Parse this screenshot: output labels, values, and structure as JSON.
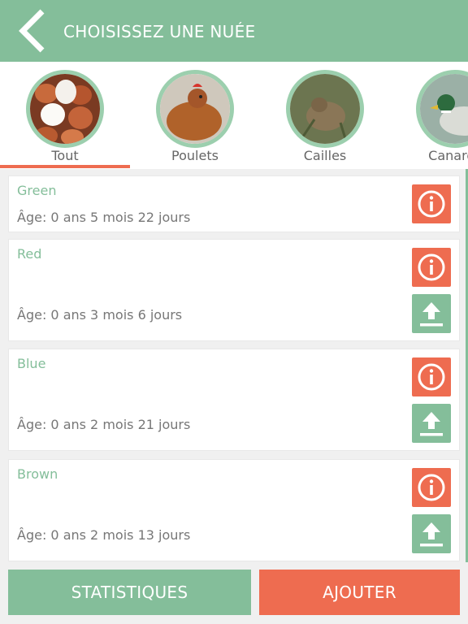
{
  "header": {
    "title": "CHOISISSEZ UNE NUÉE"
  },
  "tabs": [
    {
      "label": "Tout"
    },
    {
      "label": "Poulets"
    },
    {
      "label": "Cailles"
    },
    {
      "label": "Canards"
    }
  ],
  "flocks": [
    {
      "name": "Green",
      "age": "Âge: 0 ans 5 mois 22 jours"
    },
    {
      "name": "Red",
      "age": "Âge: 0 ans 3 mois 6 jours"
    },
    {
      "name": "Blue",
      "age": "Âge: 0 ans 2 mois 21 jours"
    },
    {
      "name": "Brown",
      "age": "Âge: 0 ans 2 mois 13 jours"
    }
  ],
  "footer": {
    "stats_label": "STATISTIQUES",
    "add_label": "AJOUTER"
  },
  "colors": {
    "green": "#84be9a",
    "coral": "#ee6c50"
  }
}
